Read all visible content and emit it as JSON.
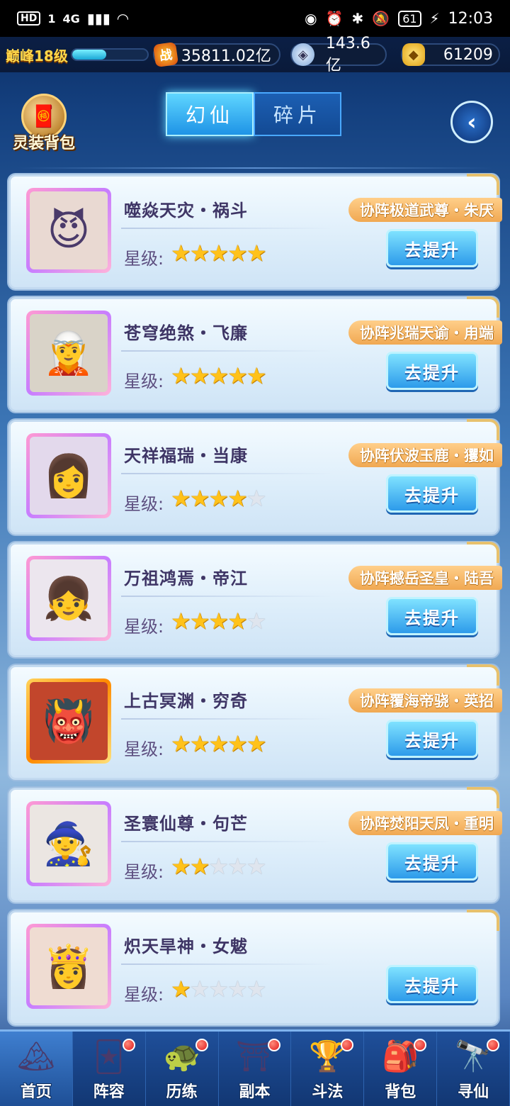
{
  "status_bar": {
    "hd": "HD",
    "sim": "1",
    "net": "4G",
    "battery": "61",
    "time": "12:03"
  },
  "resources": {
    "level": "巅峰18级",
    "exp_fraction": 0.45,
    "power_icon": "战",
    "power": "35811.02亿",
    "coins": "143.6亿",
    "gold": "61209"
  },
  "header": {
    "bag_label": "灵装背包",
    "tabs": [
      {
        "label": "幻仙",
        "active": true
      },
      {
        "label": "碎片",
        "active": false
      }
    ],
    "back_icon": "back-arrow-icon"
  },
  "star_label": "星级:",
  "upgrade_label": "去提升",
  "cards": [
    {
      "name": "噬焱天灾・祸斗",
      "synergy": "协阵极道武尊・朱厌",
      "stars": 5,
      "frame": "pink",
      "avatar": "😈",
      "bg": "#e9d9d2"
    },
    {
      "name": "苍穹绝煞・飞廉",
      "synergy": "协阵兆瑞天谕・甪端",
      "stars": 5,
      "frame": "pink",
      "avatar": "🧝",
      "bg": "#d9d3c8"
    },
    {
      "name": "天祥福瑞・当康",
      "synergy": "协阵伏波玉鹿・玃如",
      "stars": 4,
      "frame": "pink",
      "avatar": "👩",
      "bg": "#e3d9ec"
    },
    {
      "name": "万祖鸿焉・帝江",
      "synergy": "协阵撼岳圣皇・陆吾",
      "stars": 4,
      "frame": "pink",
      "avatar": "👧",
      "bg": "#ece6ee"
    },
    {
      "name": "上古冥渊・穷奇",
      "synergy": "协阵覆海帝骁・英招",
      "stars": 5,
      "frame": "gold",
      "avatar": "👹",
      "bg": "#c2462c"
    },
    {
      "name": "圣寰仙尊・句芒",
      "synergy": "协阵焚阳天凤・重明",
      "stars": 2,
      "frame": "pink",
      "avatar": "🧙",
      "bg": "#ebe6e2"
    },
    {
      "name": "炽天旱神・女魃",
      "synergy": "",
      "stars": 1,
      "frame": "pink",
      "avatar": "👸",
      "bg": "#efdcd2"
    }
  ],
  "nav": [
    {
      "label": "首页",
      "icon": "🏔",
      "dot": false,
      "active": true
    },
    {
      "label": "阵容",
      "icon": "🃏",
      "dot": true,
      "active": false
    },
    {
      "label": "历练",
      "icon": "🐢",
      "dot": true,
      "active": false
    },
    {
      "label": "副本",
      "icon": "⛩",
      "dot": true,
      "active": false
    },
    {
      "label": "斗法",
      "icon": "🏆",
      "dot": true,
      "active": false
    },
    {
      "label": "背包",
      "icon": "🎒",
      "dot": true,
      "active": false
    },
    {
      "label": "寻仙",
      "icon": "🔭",
      "dot": true,
      "active": false
    }
  ]
}
